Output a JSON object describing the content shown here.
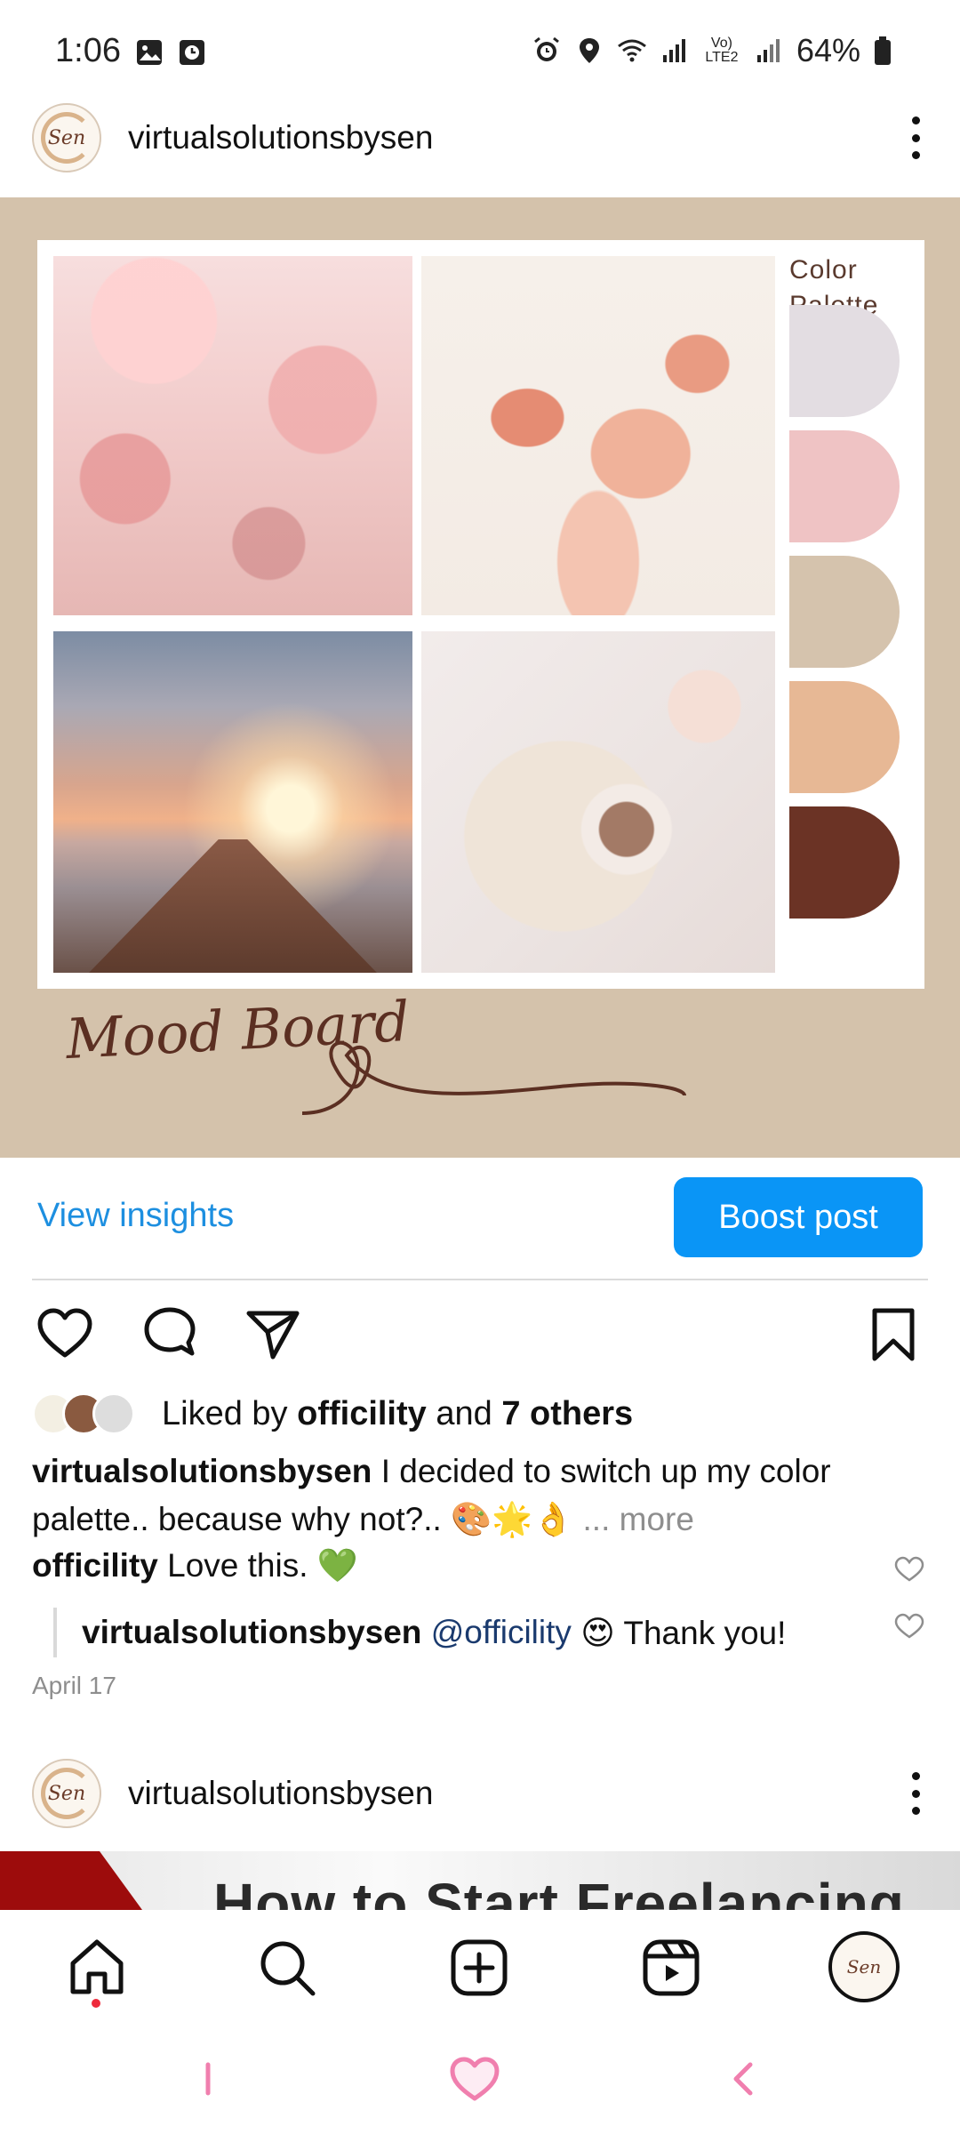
{
  "status_bar": {
    "time": "1:06",
    "battery": "64%",
    "network_label": "Vo) LTE2"
  },
  "post": {
    "username": "virtualsolutionsbysen",
    "avatar_text": "Sen",
    "image": {
      "palette_title": "Color Palette",
      "swatches": [
        "#e3dde2",
        "#efc3c4",
        "#d5c3ad",
        "#e7b895",
        "#6b3325"
      ],
      "mood_title": "Mood Board"
    },
    "insights_label": "View insights",
    "boost_label": "Boost post",
    "likes": {
      "prefix": "Liked by",
      "user": "officility",
      "connector": "and",
      "others": "7 others"
    },
    "caption": {
      "user": "virtualsolutionsbysen",
      "text": "I decided to switch up my color palette.. because why not?.. 🎨🌟👌",
      "more": "... more"
    },
    "comment": {
      "user": "officility",
      "text": "Love this. 💚"
    },
    "reply": {
      "user": "virtualsolutionsbysen",
      "mention": "@officility",
      "text": "😍 Thank you!"
    },
    "date": "April 17"
  },
  "next_post": {
    "username": "virtualsolutionsbysen",
    "avatar_text": "Sen",
    "image_title": "How to Start Freelancing"
  },
  "bottom_nav": {
    "profile_text": "Sen"
  }
}
